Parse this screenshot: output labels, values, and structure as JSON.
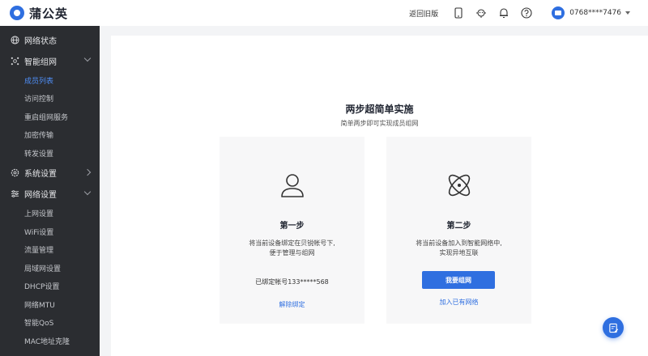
{
  "app": {
    "name": "蒲公英"
  },
  "sidebar": {
    "items": [
      {
        "label": "网络状态",
        "icon": "globe-icon",
        "expanded": null
      },
      {
        "label": "智能组网",
        "icon": "network-icon",
        "expanded": true,
        "children": [
          {
            "label": "成员列表",
            "active": true
          },
          {
            "label": "访问控制"
          },
          {
            "label": "重启组网服务"
          },
          {
            "label": "加密传输"
          },
          {
            "label": "转发设置"
          }
        ]
      },
      {
        "label": "系统设置",
        "icon": "gear-icon",
        "expanded": false
      },
      {
        "label": "网络设置",
        "icon": "settings-list-icon",
        "expanded": true,
        "children": [
          {
            "label": "上网设置"
          },
          {
            "label": "WiFi设置"
          },
          {
            "label": "流量管理"
          },
          {
            "label": "局域网设置"
          },
          {
            "label": "DHCP设置"
          },
          {
            "label": "网络MTU"
          },
          {
            "label": "智能QoS"
          },
          {
            "label": "MAC地址克隆"
          }
        ]
      }
    ]
  },
  "topbar": {
    "back_old": "返回旧版",
    "icons": [
      "phone-icon",
      "support-icon",
      "bell-icon",
      "help-icon"
    ],
    "account": "0768****7476"
  },
  "main": {
    "title": "两步超简单实施",
    "subtitle": "简单两步即可实现成员组网",
    "step1": {
      "title": "第一步",
      "desc_line1": "将当前设备绑定在贝锐帐号下,",
      "desc_line2": "便于管理与组网",
      "bound": "已绑定帐号133*****568",
      "action": "解除绑定"
    },
    "step2": {
      "title": "第二步",
      "desc_line1": "将当前设备加入到智能网络中,",
      "desc_line2": "实现异地互联",
      "primary": "我要组网",
      "secondary": "加入已有网络"
    }
  },
  "colors": {
    "accent": "#2f6fe0",
    "sidebar_bg": "#2b2d31",
    "active_link": "#4f8ff7"
  }
}
